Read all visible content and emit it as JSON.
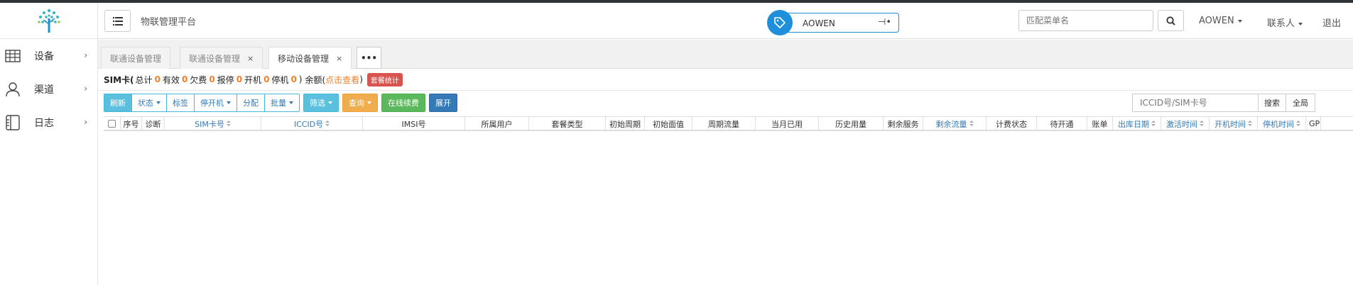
{
  "header": {
    "app_title": "物联管理平台",
    "username": "AOWEN",
    "search_placeholder": "匹配菜单名",
    "user_menu": "AOWEN",
    "contacts": "联系人",
    "logout": "退出"
  },
  "sidebar": {
    "items": [
      {
        "label": "设备",
        "icon": "table-grid-icon"
      },
      {
        "label": "渠道",
        "icon": "user-icon"
      },
      {
        "label": "日志",
        "icon": "log-book-icon"
      }
    ]
  },
  "tabs": [
    {
      "label": "联通设备管理",
      "closable": false
    },
    {
      "label": "联通设备管理",
      "closable": true
    },
    {
      "label": "移动设备管理",
      "closable": true,
      "active": true
    }
  ],
  "tab_more": "•••",
  "simbar": {
    "prefix": "SIM卡(",
    "total_label": "总计",
    "total": "0",
    "valid_label": "有效",
    "valid": "0",
    "arrears_label": "欠费",
    "arrears": "0",
    "reported_label": "报停",
    "reported": "0",
    "on_label": "开机",
    "on": "0",
    "off_label": "停机",
    "off": "0",
    "suffix": ")",
    "balance_label": "余额(",
    "balance_link": "点击查看",
    "balance_close": ")",
    "package_stats": "套餐统计"
  },
  "toolbar": {
    "refresh": "刷新",
    "status": "状态",
    "tag": "标签",
    "power": "停开机",
    "assign": "分配",
    "batch": "批量",
    "filter": "筛选",
    "query": "查询",
    "renew": "在线续费",
    "expand": "展开"
  },
  "search": {
    "placeholder": "ICCID号/SIM卡号",
    "search_button": "搜索",
    "all_button": "全局"
  },
  "table": {
    "columns": [
      "序号",
      "诊断",
      "SIM卡号",
      "ICCID号",
      "IMSI号",
      "所属用户",
      "套餐类型",
      "初始周期",
      "初始面值",
      "周期流量",
      "当月已用",
      "历史用量",
      "剩余服务",
      "剩余流量",
      "计费状态",
      "待开通",
      "账单",
      "出库日期",
      "激活时间",
      "开机时间",
      "停机时间",
      "GP"
    ]
  },
  "colors": {
    "accent": "#1d8fdb",
    "info": "#5bc0de",
    "warning": "#f0ad4e",
    "success": "#5cb85c",
    "primary": "#337ab7",
    "danger": "#d9534f",
    "count": "#f0802c"
  }
}
